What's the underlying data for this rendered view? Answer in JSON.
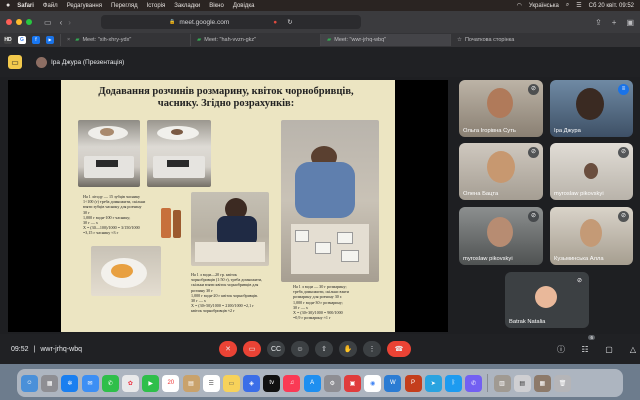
{
  "menubar": {
    "apple": "",
    "items": [
      "Safari",
      "Файл",
      "Редагування",
      "Перегляд",
      "Історія",
      "Закладки",
      "Вікно",
      "Довідка"
    ],
    "input_source": "Українська",
    "datetime": "Сб 20 квіт.  09:52"
  },
  "browser": {
    "address": "meet.google.com",
    "favorites": [
      "HD",
      "G",
      "f"
    ],
    "tabs": [
      {
        "label": "Meet: \"xih-xhry-ydx\""
      },
      {
        "label": "Meet: \"hah-vvzn-gkz\""
      },
      {
        "label": "Meet: \"wwr-jrhq-wbq\""
      },
      {
        "label": "Початкова сторінка"
      }
    ]
  },
  "meet": {
    "presenter_label": "Іра Джура (Презентація)",
    "time": "09:52",
    "meeting_code": "wwr-jrhq-wbq",
    "participants_badge": "6"
  },
  "slide": {
    "title": "Додавання розчинів розмарину, квіток чорнобривців, часнику. Згідно розрахунків:",
    "text1": "На 1 літоду — 15 зубців часнику\n1÷100 (г) треба домножити, скільки\nвзяти зубців часнику для розчину\n30 г\n1,000 г води-100 г часнику;\n30 г — х\nХ = (30—100)/1000 = 3/150/1000\n=3,15 г часнику ≈3 г",
    "text2": "На 1 л води—20 гр. квіток\nчорнобривців (1:50 г), треба домножити,\nскільки взяти квіток чорнобривців для\nрозчину 30 г\n1,000 г води-20 г квіток чорнобривців.\n30 г — х\nХ = (30+50)/1000 = 2100/1000 =2,1 г\nквіток чорнобривців ≈2 г",
    "text3": "На 1 л води — 30 г розмарину;\nтреба домножити, скільки взяти\nрозмарину для розчину 30 г.\n1,000 г води-30 г розмарину;\n30 г — х\nХ = (30+30)/1000 = 900/1000\n=0,9 г розмарину ≈1 г"
  },
  "participants": [
    {
      "name": "Ольга Ігорівна Суть"
    },
    {
      "name": "Іра Джура"
    },
    {
      "name": "Олена Бацта"
    },
    {
      "name": "myroslaw pikovskyi"
    },
    {
      "name": "myroslaw pikovskyi"
    },
    {
      "name": "Кузьминська Алла"
    },
    {
      "name": "Batrak Natalia"
    }
  ],
  "colors": {
    "meet_bg": "#202124",
    "slide_bg": "#ece5c2",
    "end_call": "#ea4335",
    "accent_blue": "#1a73e8",
    "present_yellow": "#f2c94c"
  },
  "icons": {
    "mic_off": "mic-off-icon",
    "camera_off": "camera-off-icon",
    "captions": "captions-icon",
    "emoji": "emoji-icon",
    "present": "present-icon",
    "hand": "raise-hand-icon",
    "more": "more-icon",
    "end": "end-call-icon",
    "info": "info-icon",
    "people": "people-icon",
    "chat": "chat-icon",
    "activities": "activities-icon"
  }
}
